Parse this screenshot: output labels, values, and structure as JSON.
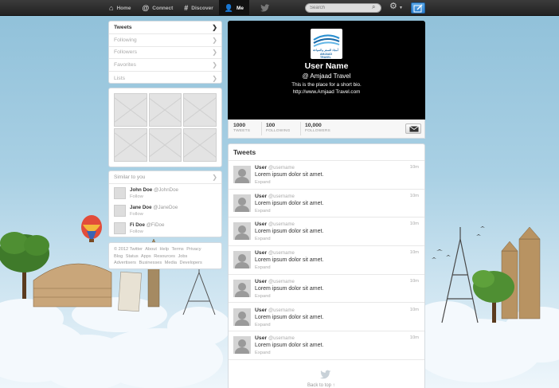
{
  "topbar": {
    "nav": [
      {
        "label": "Home",
        "icon": "home-icon"
      },
      {
        "label": "Connect",
        "icon": "at-icon"
      },
      {
        "label": "Discover",
        "icon": "hashtag-icon"
      },
      {
        "label": "Me",
        "icon": "person-icon"
      }
    ],
    "search_placeholder": "Search"
  },
  "sidebar": {
    "menu": [
      {
        "label": "Tweets"
      },
      {
        "label": "Following"
      },
      {
        "label": "Followers"
      },
      {
        "label": "Favorites"
      },
      {
        "label": "Lists"
      }
    ],
    "similar_title": "Similar to you",
    "similar_users": [
      {
        "name": "John Doe",
        "handle": "@JohnDoe",
        "action": "Follow"
      },
      {
        "name": "Jane Doe",
        "handle": "@JaneDoe",
        "action": "Follow"
      },
      {
        "name": "Fi Doe",
        "handle": "@FiDoe",
        "action": "Follow"
      }
    ],
    "footer_links": [
      "© 2012 Twitter",
      "About",
      "Help",
      "Terms",
      "Privacy",
      "Blog",
      "Status",
      "Apps",
      "Resources",
      "Jobs",
      "Advertisers",
      "Businesses",
      "Media",
      "Developers"
    ]
  },
  "profile": {
    "logo_arabic": "أمجاد للسفر والسياحة",
    "logo_text": "AMJAAD TRAVEL",
    "name": "User Name",
    "handle": "@  Amjaad Travel",
    "bio": "This is the place for a short bio.",
    "url": "http://www.Amjaad Travel.com"
  },
  "stats": [
    {
      "value": "1000",
      "label": "TWEETS"
    },
    {
      "value": "100",
      "label": "FOLLOWING"
    },
    {
      "value": "10,000",
      "label": "FOLLOWERS"
    }
  ],
  "timeline": {
    "title": "Tweets",
    "tweets": [
      {
        "user": "User",
        "handle": "@username",
        "text": "Lorem ipsum dolor sit amet.",
        "action": "Expand",
        "time": "10m"
      },
      {
        "user": "User",
        "handle": "@username",
        "text": "Lorem ipsum dolor sit amet.",
        "action": "Expand",
        "time": "10m"
      },
      {
        "user": "User",
        "handle": "@username",
        "text": "Lorem ipsum dolor sit amet.",
        "action": "Expand",
        "time": "10m"
      },
      {
        "user": "User",
        "handle": "@username",
        "text": "Lorem ipsum dolor sit amet.",
        "action": "Expand",
        "time": "10m"
      },
      {
        "user": "User",
        "handle": "@username",
        "text": "Lorem ipsum dolor sit amet.",
        "action": "Expand",
        "time": "10m"
      },
      {
        "user": "User",
        "handle": "@username",
        "text": "Lorem ipsum dolor sit amet.",
        "action": "Expand",
        "time": "10m"
      },
      {
        "user": "User",
        "handle": "@username",
        "text": "Lorem ipsum dolor sit amet.",
        "action": "Expand",
        "time": "10m"
      }
    ],
    "back_to_top": "Back to top ↑"
  },
  "colors": {
    "topbar": "#2b2b2b",
    "compose": "#2c7fcf",
    "profile_header": "#000000"
  }
}
